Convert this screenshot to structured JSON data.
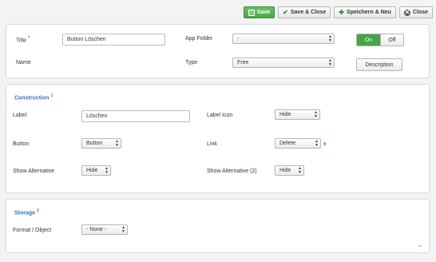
{
  "toolbar": {
    "save": "Save",
    "save_close": "Save & Close",
    "save_new": "Speichern & Neu",
    "close": "Close"
  },
  "top": {
    "title_label": "Title",
    "title_required": "*",
    "title_value": "Button Löschen",
    "app_folder_label": "App Folder",
    "app_folder_prefix": "-",
    "app_folder_value": "",
    "toggle_on": "On",
    "toggle_off": "Off",
    "name_label": "Name",
    "type_label": "Type",
    "type_value": "Free",
    "description_button": "Description"
  },
  "construction": {
    "title": "Construction",
    "badge": "1",
    "label_label": "Label",
    "label_value": "Löschen",
    "label_icon_label": "Label Icon",
    "label_icon_value": "Hide",
    "button_label": "Button",
    "button_value": "Button",
    "link_label": "Link",
    "link_value": "Delete",
    "show_alt_label": "Show Alternative",
    "show_alt_value": "Hide",
    "show_alt2_label": "Show Alternative (2)",
    "show_alt2_value": "Hide"
  },
  "storage": {
    "title": "Storage",
    "badge": "2",
    "format_label": "Format / Object",
    "format_value": "- None -"
  },
  "colors": {
    "accent": "#3a73b3",
    "success": "#46a546",
    "chevron": "#e8a33b"
  }
}
